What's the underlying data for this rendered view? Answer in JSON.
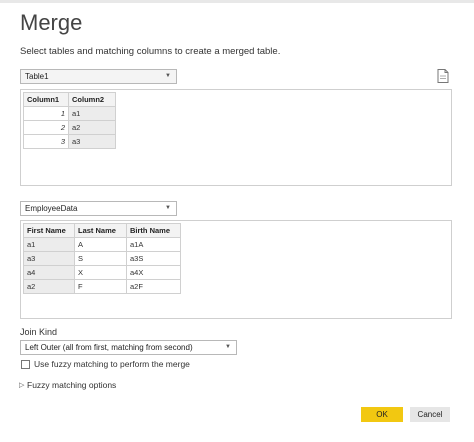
{
  "dialog": {
    "title": "Merge",
    "subtitle": "Select tables and matching columns to create a merged table."
  },
  "first_table": {
    "selected": "Table1",
    "columns": [
      "Column1",
      "Column2"
    ],
    "rows": [
      [
        "1",
        "a1"
      ],
      [
        "2",
        "a2"
      ],
      [
        "3",
        "a3"
      ]
    ]
  },
  "second_table": {
    "selected": "EmployeeData",
    "columns": [
      "First Name",
      "Last Name",
      "Birth Name"
    ],
    "rows": [
      [
        "a1",
        "A",
        "a1A"
      ],
      [
        "a3",
        "S",
        "a3S"
      ],
      [
        "a4",
        "X",
        "a4X"
      ],
      [
        "a2",
        "F",
        "a2F"
      ]
    ]
  },
  "join_kind": {
    "label": "Join Kind",
    "selected": "Left Outer (all from first, matching from second)"
  },
  "fuzzy": {
    "checkbox_label": "Use fuzzy matching to perform the merge",
    "checked": false,
    "options_label": "Fuzzy matching options"
  },
  "buttons": {
    "ok": "OK",
    "cancel": "Cancel"
  },
  "icons": {
    "dropdown": "chevron-down-icon",
    "file": "file-icon",
    "expander": "chevron-right-icon"
  },
  "colors": {
    "ok_button": "#f2c811",
    "selected_column_shade": "#ececec"
  }
}
